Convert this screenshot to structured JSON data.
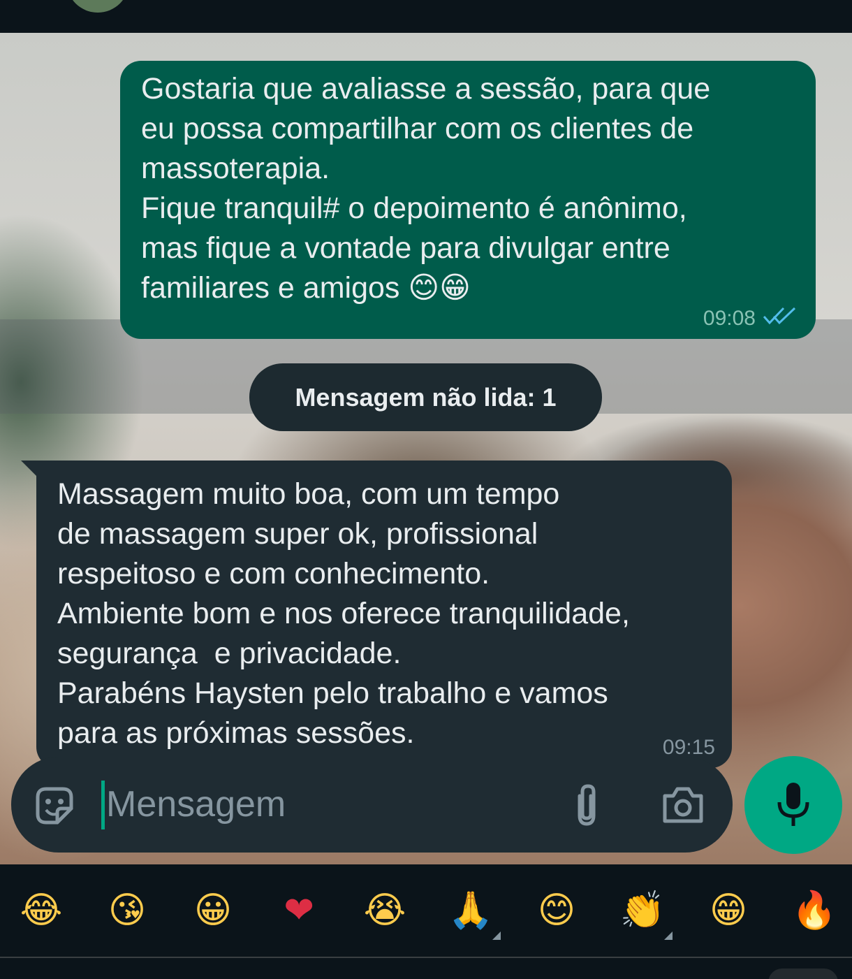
{
  "chat": {
    "outgoing_message": {
      "text": "Gostaria que avaliasse a sessão, para que\neu possa compartilhar com os clientes de\nmassoterapia.\nFique tranquil# o depoimento é anônimo,\nmas fique a vontade para divulgar entre\nfamiliares e amigos 😊😁",
      "time": "09:08",
      "status_icon": "double-check-read-icon"
    },
    "unread_divider": "Mensagem não lida: 1",
    "incoming_message": {
      "text": "Massagem muito boa, com um tempo\nde massagem super ok, profissional\nrespeitoso e com conhecimento.\nAmbiente bom e nos oferece tranquilidade,\nsegurança  e privacidade.\nParabéns Haysten pelo trabalho e vamos\npara as próximas sessões.",
      "time": "09:15"
    }
  },
  "composer": {
    "placeholder": "Mensagem",
    "value": "",
    "icons": [
      "sticker-icon",
      "paperclip-icon",
      "camera-icon",
      "microphone-icon"
    ]
  },
  "emoji_bar": {
    "emojis": [
      "😂",
      "😘",
      "😀",
      "❤",
      "😭",
      "🙏",
      "😊",
      "👏",
      "😁",
      "🔥"
    ]
  },
  "colors": {
    "outgoing_bubble": "#005c4b",
    "incoming_bubble": "#1f2c33",
    "accent": "#00a884",
    "background": "#0b141a"
  }
}
